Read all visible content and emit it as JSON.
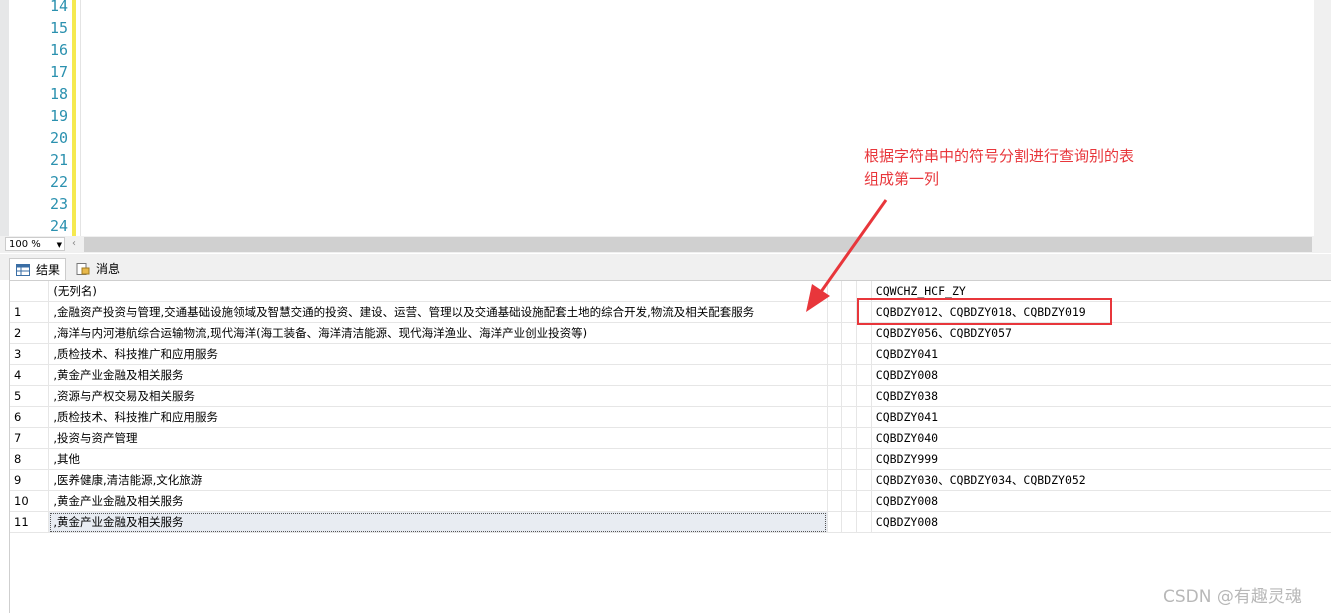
{
  "editor": {
    "line_numbers": [
      "14",
      "15",
      "16",
      "17",
      "18",
      "19",
      "20",
      "21",
      "22",
      "23",
      "24"
    ]
  },
  "zoom": {
    "value": "100 %"
  },
  "tabs": {
    "results": "结果",
    "messages": "消息"
  },
  "grid": {
    "col1_header": "(无列名)",
    "col2_header": "CQWCHZ_HCF_ZY",
    "rows": [
      {
        "n": "1",
        "c1": ",金融资产投资与管理,交通基础设施领域及智慧交通的投资、建设、运营、管理以及交通基础设施配套土地的综合开发,物流及相关配套服务",
        "c2": "CQBDZY012、CQBDZY018、CQBDZY019"
      },
      {
        "n": "2",
        "c1": ",海洋与内河港航综合运输物流,现代海洋(海工装备、海洋清洁能源、现代海洋渔业、海洋产业创业投资等)",
        "c2": "CQBDZY056、CQBDZY057"
      },
      {
        "n": "3",
        "c1": ",质检技术、科技推广和应用服务",
        "c2": "CQBDZY041"
      },
      {
        "n": "4",
        "c1": ",黄金产业金融及相关服务",
        "c2": "CQBDZY008"
      },
      {
        "n": "5",
        "c1": ",资源与产权交易及相关服务",
        "c2": "CQBDZY038"
      },
      {
        "n": "6",
        "c1": ",质检技术、科技推广和应用服务",
        "c2": "CQBDZY041"
      },
      {
        "n": "7",
        "c1": ",投资与资产管理",
        "c2": "CQBDZY040"
      },
      {
        "n": "8",
        "c1": ",其他",
        "c2": "CQBDZY999"
      },
      {
        "n": "9",
        "c1": ",医养健康,清洁能源,文化旅游",
        "c2": "CQBDZY030、CQBDZY034、CQBDZY052"
      },
      {
        "n": "10",
        "c1": ",黄金产业金融及相关服务",
        "c2": "CQBDZY008"
      },
      {
        "n": "11",
        "c1": ",黄金产业金融及相关服务",
        "c2": "CQBDZY008"
      }
    ]
  },
  "annotation": {
    "line1": "根据字符串中的符号分割进行查询别的表",
    "line2": "组成第一列",
    "color": "#e8363b"
  },
  "watermark": "CSDN @有趣灵魂"
}
